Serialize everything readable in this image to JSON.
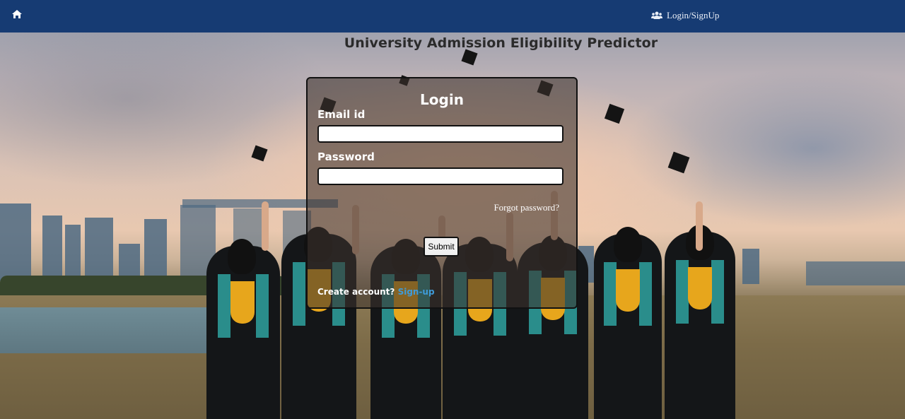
{
  "nav": {
    "home_icon": "home-icon",
    "login_icon": "users-icon",
    "login_label": "Login/SignUp",
    "bg_color": "#163b73"
  },
  "page": {
    "title": "University Admission Eligibility Predictor"
  },
  "login": {
    "title": "Login",
    "email_label": "Email id",
    "email_value": "",
    "password_label": "Password",
    "password_value": "",
    "forgot_label": "Forgot password?",
    "submit_label": "Submit",
    "create_prompt": "Create account?",
    "signup_label": "Sign-up"
  },
  "colors": {
    "accent_link": "#3f9bd8"
  }
}
